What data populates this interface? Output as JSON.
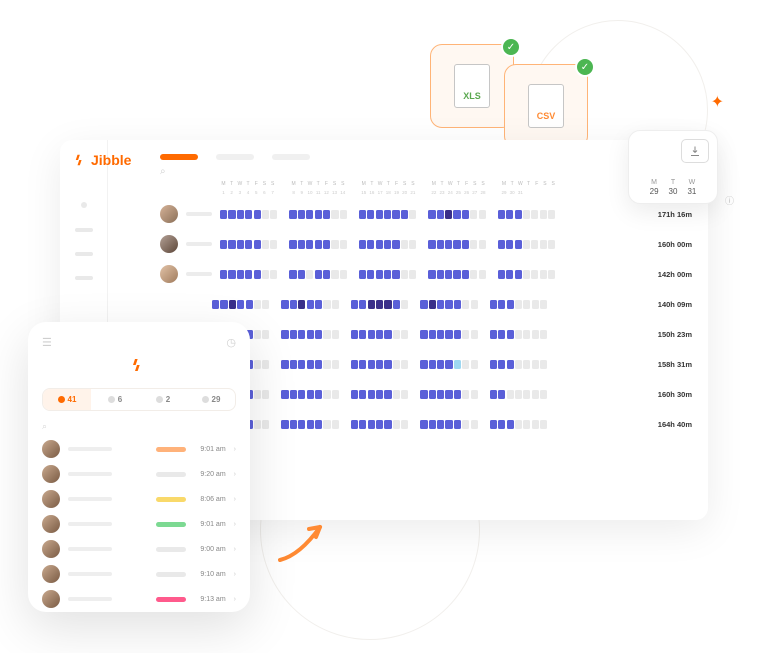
{
  "brand": "Jibble",
  "filecards": {
    "xls": "XLS",
    "csv": "CSV"
  },
  "download": {
    "dates": [
      {
        "d": "M",
        "n": "29"
      },
      {
        "d": "T",
        "n": "30"
      },
      {
        "d": "W",
        "n": "31"
      }
    ]
  },
  "day_letters": [
    "M",
    "T",
    "W",
    "T",
    "F",
    "S",
    "S"
  ],
  "week_nums": [
    [
      "1",
      "2",
      "3",
      "4",
      "5",
      "6",
      "7"
    ],
    [
      "8",
      "9",
      "10",
      "11",
      "12",
      "13",
      "14"
    ],
    [
      "15",
      "16",
      "17",
      "18",
      "19",
      "20",
      "21"
    ],
    [
      "22",
      "23",
      "24",
      "25",
      "26",
      "27",
      "28"
    ],
    [
      "29",
      "30",
      "31",
      "",
      "",
      "",
      ""
    ]
  ],
  "rows": [
    {
      "total": "171h 16m",
      "pattern": [
        [
          "b",
          "b",
          "b",
          "b",
          "b",
          "g",
          "g"
        ],
        [
          "b",
          "b",
          "b",
          "b",
          "b",
          "g",
          "g"
        ],
        [
          "b",
          "b",
          "b",
          "b",
          "b",
          "b",
          "g"
        ],
        [
          "b",
          "b",
          "d",
          "b",
          "b",
          "g",
          "g"
        ],
        [
          "b",
          "b",
          "b",
          "g",
          "g",
          "g",
          "g"
        ]
      ]
    },
    {
      "total": "160h 00m",
      "pattern": [
        [
          "b",
          "b",
          "b",
          "b",
          "b",
          "g",
          "g"
        ],
        [
          "b",
          "b",
          "b",
          "b",
          "b",
          "g",
          "g"
        ],
        [
          "b",
          "b",
          "b",
          "b",
          "b",
          "g",
          "g"
        ],
        [
          "b",
          "b",
          "b",
          "b",
          "b",
          "g",
          "g"
        ],
        [
          "b",
          "b",
          "b",
          "g",
          "g",
          "g",
          "g"
        ]
      ]
    },
    {
      "total": "142h 00m",
      "pattern": [
        [
          "b",
          "b",
          "b",
          "b",
          "b",
          "g",
          "g"
        ],
        [
          "b",
          "b",
          "g",
          "b",
          "b",
          "g",
          "g"
        ],
        [
          "b",
          "b",
          "b",
          "b",
          "b",
          "g",
          "g"
        ],
        [
          "b",
          "b",
          "b",
          "b",
          "b",
          "g",
          "g"
        ],
        [
          "b",
          "b",
          "b",
          "g",
          "g",
          "g",
          "g"
        ]
      ]
    },
    {
      "total": "140h 09m",
      "pattern": [
        [
          "b",
          "b",
          "d",
          "b",
          "b",
          "g",
          "g"
        ],
        [
          "b",
          "b",
          "d",
          "b",
          "b",
          "g",
          "g"
        ],
        [
          "b",
          "b",
          "d",
          "d",
          "d",
          "b",
          "g"
        ],
        [
          "b",
          "d",
          "b",
          "b",
          "b",
          "g",
          "g"
        ],
        [
          "b",
          "b",
          "b",
          "g",
          "g",
          "g",
          "g"
        ]
      ]
    },
    {
      "total": "150h 23m",
      "pattern": [
        [
          "b",
          "d",
          "b",
          "b",
          "b",
          "g",
          "g"
        ],
        [
          "b",
          "b",
          "b",
          "b",
          "b",
          "g",
          "g"
        ],
        [
          "b",
          "b",
          "b",
          "b",
          "b",
          "g",
          "g"
        ],
        [
          "b",
          "b",
          "b",
          "b",
          "b",
          "g",
          "g"
        ],
        [
          "b",
          "b",
          "b",
          "g",
          "g",
          "g",
          "g"
        ]
      ]
    },
    {
      "total": "158h 31m",
      "pattern": [
        [
          "b",
          "b",
          "g",
          "b",
          "b",
          "g",
          "g"
        ],
        [
          "b",
          "b",
          "b",
          "b",
          "b",
          "g",
          "g"
        ],
        [
          "b",
          "b",
          "b",
          "b",
          "b",
          "g",
          "g"
        ],
        [
          "b",
          "b",
          "b",
          "b",
          "l",
          "g",
          "g"
        ],
        [
          "b",
          "b",
          "b",
          "g",
          "g",
          "g",
          "g"
        ]
      ]
    },
    {
      "total": "160h 30m",
      "pattern": [
        [
          "b",
          "b",
          "b",
          "b",
          "b",
          "g",
          "g"
        ],
        [
          "b",
          "b",
          "b",
          "b",
          "b",
          "g",
          "g"
        ],
        [
          "b",
          "b",
          "b",
          "b",
          "b",
          "g",
          "g"
        ],
        [
          "b",
          "b",
          "b",
          "b",
          "b",
          "g",
          "g"
        ],
        [
          "b",
          "b",
          "g",
          "g",
          "g",
          "g",
          "g"
        ]
      ]
    },
    {
      "total": "164h 40m",
      "pattern": [
        [
          "b",
          "b",
          "d",
          "b",
          "b",
          "g",
          "g"
        ],
        [
          "b",
          "b",
          "b",
          "b",
          "b",
          "g",
          "g"
        ],
        [
          "b",
          "b",
          "b",
          "b",
          "b",
          "g",
          "g"
        ],
        [
          "b",
          "b",
          "b",
          "b",
          "b",
          "g",
          "g"
        ],
        [
          "b",
          "b",
          "b",
          "g",
          "g",
          "g",
          "g"
        ]
      ]
    }
  ],
  "mobile": {
    "stats": [
      {
        "icon": "person-icon",
        "num": "41",
        "active": true
      },
      {
        "icon": "in-icon",
        "num": "6"
      },
      {
        "icon": "out-icon",
        "num": "2"
      },
      {
        "icon": "away-icon",
        "num": "29"
      }
    ],
    "list": [
      {
        "time": "9:01 am",
        "color": "#ffb27a"
      },
      {
        "time": "9:20 am",
        "color": "#e9e9e9"
      },
      {
        "time": "8:06 am",
        "color": "#f9d96a"
      },
      {
        "time": "9:01 am",
        "color": "#7cd992"
      },
      {
        "time": "9:00 am",
        "color": "#e9e9e9"
      },
      {
        "time": "9:10 am",
        "color": "#e9e9e9"
      },
      {
        "time": "9:13 am",
        "color": "#ff5a8c"
      }
    ]
  }
}
